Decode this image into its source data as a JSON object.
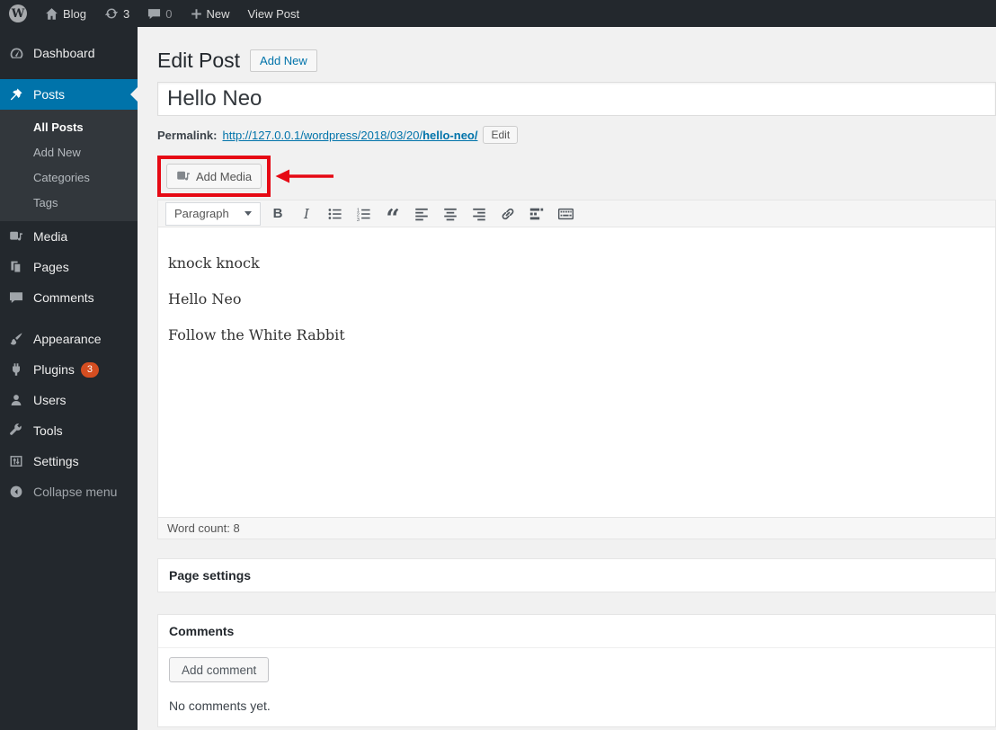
{
  "colors": {
    "admin_dark": "#23282d",
    "submenu_dark": "#32373c",
    "accent_blue": "#0073aa",
    "badge_orange": "#d54e21",
    "annotation_red": "#e60914",
    "content_background": "#f1f1f1"
  },
  "admin_bar": {
    "wp_logo_glyph": "W",
    "site_name": "Blog",
    "update_count": "3",
    "comment_count": "0",
    "new_label": "New",
    "view_post_label": "View Post"
  },
  "sidebar": {
    "items": [
      {
        "label": "Dashboard"
      },
      {
        "label": "Posts",
        "active": true
      },
      {
        "label": "Media"
      },
      {
        "label": "Pages"
      },
      {
        "label": "Comments"
      },
      {
        "label": "Appearance"
      },
      {
        "label": "Plugins",
        "badge": "3"
      },
      {
        "label": "Users"
      },
      {
        "label": "Tools"
      },
      {
        "label": "Settings"
      },
      {
        "label": "Collapse menu"
      }
    ],
    "posts_submenu": [
      {
        "label": "All Posts",
        "current": true
      },
      {
        "label": "Add New"
      },
      {
        "label": "Categories"
      },
      {
        "label": "Tags"
      }
    ]
  },
  "main": {
    "page_title": "Edit Post",
    "add_new_button": "Add New",
    "post_title": "Hello Neo",
    "permalink": {
      "label": "Permalink:",
      "url_prefix": "http://127.0.0.1/wordpress/2018/03/20/",
      "slug": "hello-neo/",
      "edit_button": "Edit"
    },
    "add_media_button": "Add Media",
    "editor": {
      "block_format": "Paragraph",
      "bold_glyph": "B",
      "italic_glyph": "I",
      "quote_glyph": "“",
      "lines": [
        "knock knock",
        "Hello Neo",
        "Follow the White Rabbit"
      ],
      "word_count_text": "Word count: 8"
    },
    "panels": {
      "page_settings_title": "Page settings",
      "comments_title": "Comments",
      "add_comment_button": "Add comment",
      "no_comments_text": "No comments yet."
    }
  }
}
